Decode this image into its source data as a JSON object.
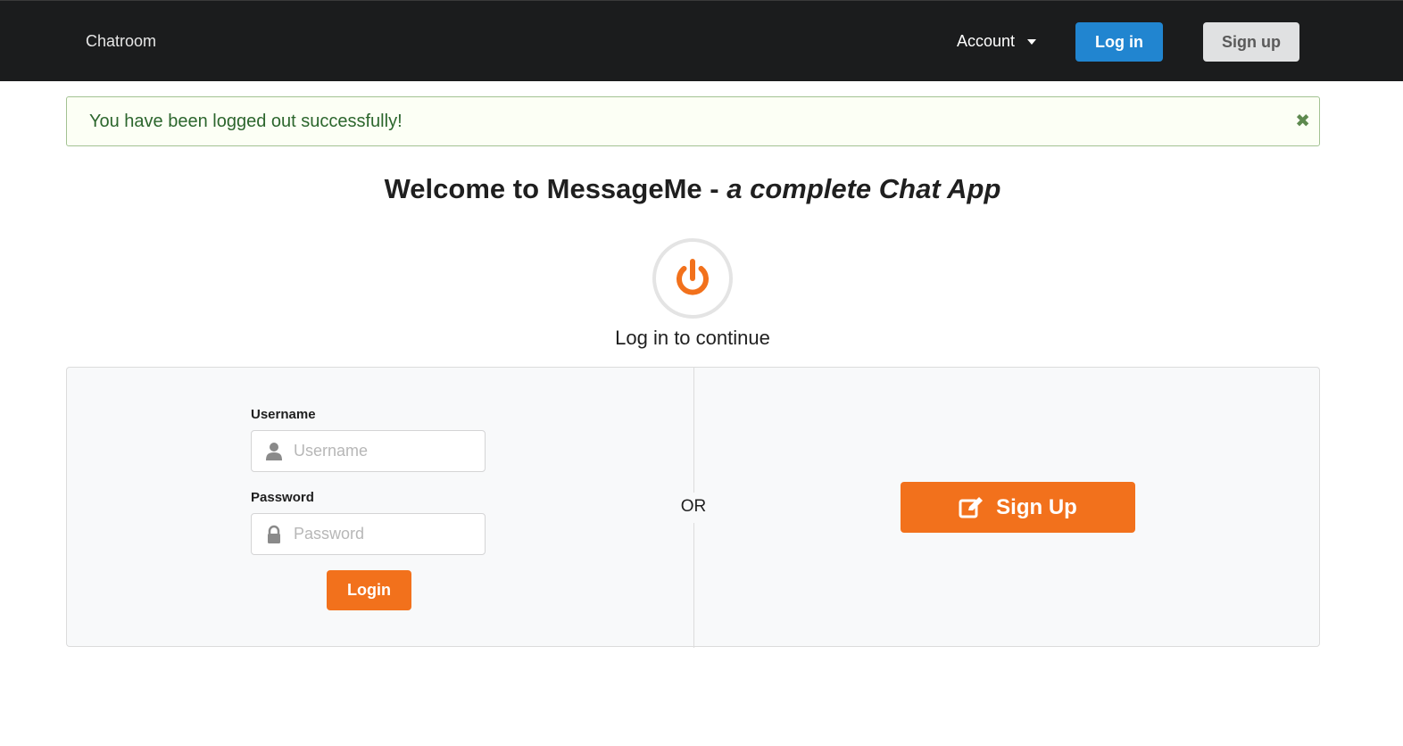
{
  "navbar": {
    "brand": "Chatroom",
    "account_label": "Account",
    "login_label": "Log in",
    "signup_label": "Sign up"
  },
  "alert": {
    "message": "You have been logged out successfully!",
    "close_glyph": "✖"
  },
  "welcome": {
    "title_main": "Welcome to MessageMe - ",
    "title_italic": "a complete Chat App"
  },
  "subheading": "Log in to continue",
  "form": {
    "username_label": "Username",
    "username_placeholder": "Username",
    "username_value": "",
    "password_label": "Password",
    "password_placeholder": "Password",
    "password_value": "",
    "login_label": "Login"
  },
  "divider_text": "OR",
  "signup_big_label": "Sign Up",
  "colors": {
    "navbar_bg": "#1b1c1d",
    "primary_blue": "#2185d0",
    "accent_orange": "#f2711c",
    "success_text": "#2c662d",
    "success_border": "#a3c293"
  },
  "icons": {
    "power": "power-icon",
    "user": "user-icon",
    "lock": "lock-icon",
    "edit": "edit-icon",
    "close": "close-icon",
    "caret": "caret-down-icon"
  }
}
